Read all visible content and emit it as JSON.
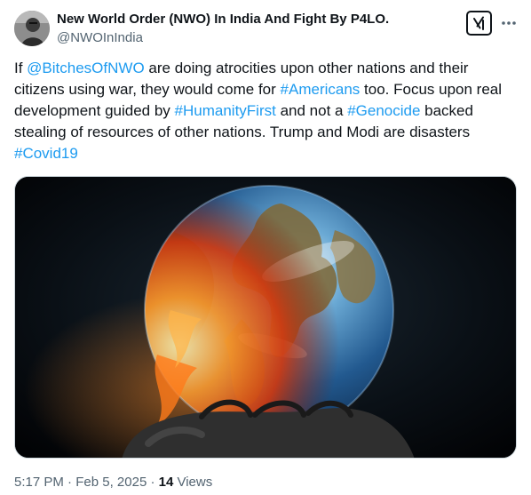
{
  "author": {
    "display_name": "New World Order (NWO) In India And Fight By P4LO.",
    "handle": "@NWOInIndia",
    "avatar": "avatar-photo"
  },
  "icons": {
    "grok": "grok-icon",
    "more": "more-options-icon"
  },
  "tweet": {
    "segments": [
      {
        "text": "If ",
        "link": false
      },
      {
        "text": "@BitchesOfNWO",
        "link": true
      },
      {
        "text": " are doing atrocities upon other nations and their citizens using war, they would come for ",
        "link": false
      },
      {
        "text": "#Americans",
        "link": true
      },
      {
        "text": " too. Focus upon real development guided by ",
        "link": false
      },
      {
        "text": "#HumanityFirst",
        "link": true
      },
      {
        "text": " and not a ",
        "link": false
      },
      {
        "text": "#Genocide",
        "link": true
      },
      {
        "text": " backed stealing of resources of other nations. Trump and Modi are disasters ",
        "link": false
      },
      {
        "text": "#Covid19",
        "link": true
      }
    ]
  },
  "media": {
    "description_icon": "burning-earth-in-hand-image"
  },
  "meta": {
    "time": "5:17 PM",
    "separator1": " · ",
    "date": "Feb 5, 2025",
    "separator2": " · ",
    "views_count": "14",
    "views_label": " Views"
  },
  "colors": {
    "link": "#1d9bf0",
    "text": "#0f1419",
    "secondary": "#536471"
  }
}
